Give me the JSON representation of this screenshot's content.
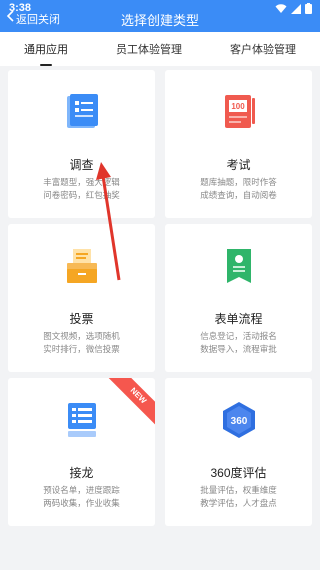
{
  "status": {
    "time": "3:38"
  },
  "nav": {
    "back_label": "返回",
    "close_label": "关闭",
    "title": "选择创建类型"
  },
  "tabs": [
    {
      "label": "通用应用",
      "active": true
    },
    {
      "label": "员工体验管理",
      "active": false
    },
    {
      "label": "客户体验管理",
      "active": false
    }
  ],
  "cards": [
    {
      "title": "调查",
      "desc1": "丰富题型，强大逻辑",
      "desc2": "问卷密码，红包抽奖",
      "icon": "survey-icon",
      "color": "#3b8cf6"
    },
    {
      "title": "考试",
      "desc1": "题库抽题，限时作答",
      "desc2": "成绩查询，自动阅卷",
      "icon": "exam-icon",
      "color": "#f05a4f"
    },
    {
      "title": "投票",
      "desc1": "图文视频，选项随机",
      "desc2": "实时排行，微信投票",
      "icon": "vote-icon",
      "color": "#f5a623"
    },
    {
      "title": "表单流程",
      "desc1": "信息登记，活动报名",
      "desc2": "数据导入，流程审批",
      "icon": "form-icon",
      "color": "#2fb56a"
    },
    {
      "title": "接龙",
      "desc1": "预设名单，进度跟踪",
      "desc2": "两码收集，作业收集",
      "icon": "chain-icon",
      "color": "#3b8cf6",
      "badge": "NEW"
    },
    {
      "title": "360度评估",
      "desc1": "批量评估，权重维度",
      "desc2": "教学评估，人才盘点",
      "icon": "360-icon",
      "color": "#2f6fe0"
    }
  ]
}
